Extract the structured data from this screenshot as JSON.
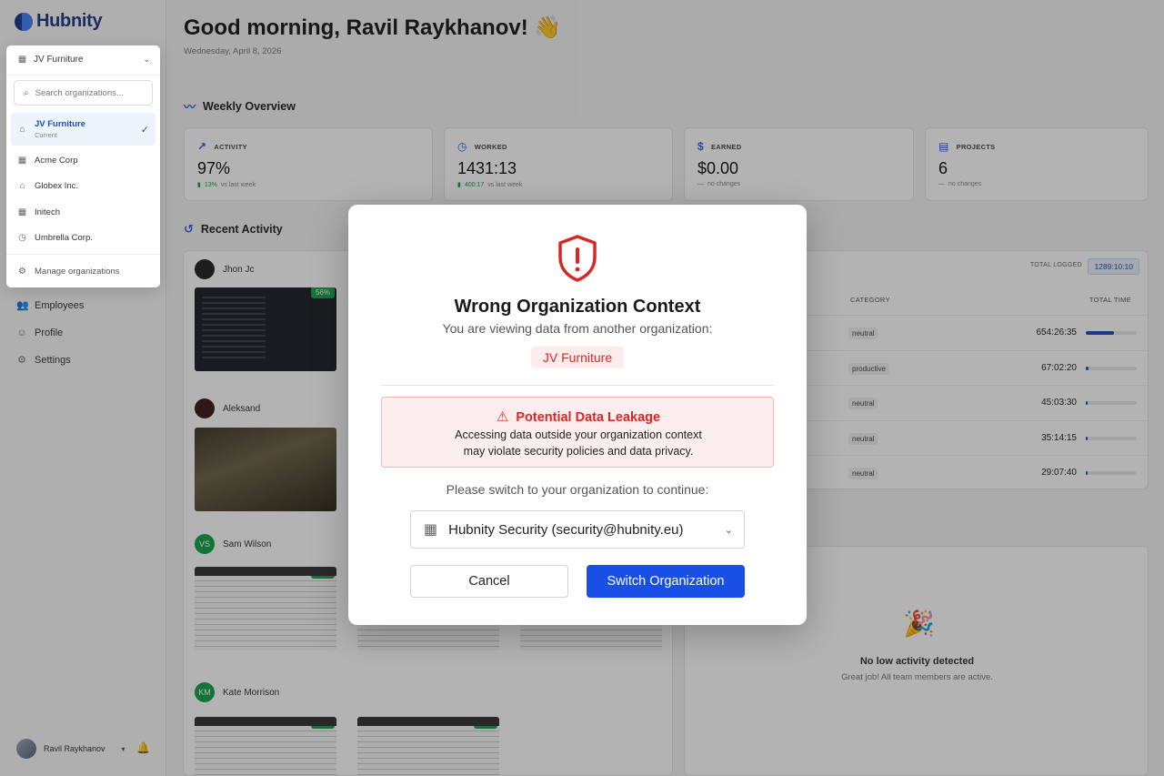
{
  "app": {
    "logo_text": "Hubnity"
  },
  "header": {
    "greeting": "Good morning, Ravil Raykhanov! 👋",
    "date": "Wednesday, April 8, 2026"
  },
  "org_dropdown": {
    "current": "JV Furniture",
    "search_placeholder": "Search organizations...",
    "items": [
      {
        "name": "JV Furniture",
        "sub": "Current"
      },
      {
        "name": "Acme Corp"
      },
      {
        "name": "Globex Inc."
      },
      {
        "name": "Initech"
      },
      {
        "name": "Umbrella Corp."
      }
    ],
    "manage_label": "Manage organizations"
  },
  "sidebar": {
    "items": [
      {
        "label": "Employees"
      },
      {
        "label": "Profile"
      },
      {
        "label": "Settings"
      }
    ],
    "user_name": "Ravil Raykhanov"
  },
  "weekly": {
    "title": "Weekly Overview",
    "stats": [
      {
        "label": "ACTIVITY",
        "value": "97%",
        "change": "13%",
        "change_note": "vs last week"
      },
      {
        "label": "WORKED",
        "value": "1431:13",
        "change": "400:17",
        "change_note": "vs last week"
      },
      {
        "label": "EARNED",
        "value": "$0.00",
        "change": "—",
        "change_note": "no changes"
      },
      {
        "label": "PROJECTS",
        "value": "6",
        "change": "—",
        "change_note": "no changes"
      }
    ]
  },
  "recent": {
    "title": "Recent Activity",
    "people": [
      {
        "name": "Jhon Jc",
        "initials": "",
        "pct": "56%"
      },
      {
        "name": "Aleksand",
        "initials": ""
      },
      {
        "name": "Sam Wilson",
        "initials": "VS",
        "pct": "79%"
      },
      {
        "name": "Kate Morrison",
        "initials": "KM",
        "pct": "71%",
        "pct2": "71%"
      }
    ]
  },
  "apps_table": {
    "total_logged_label": "TOTAL LOGGED",
    "total_logged_value": "1289:10:10",
    "col_category": "CATEGORY",
    "col_time": "TOTAL TIME",
    "rows": [
      {
        "category": "neutral",
        "time": "654:26:35",
        "share": 0.55
      },
      {
        "category": "productive",
        "time": "67:02:20",
        "share": 0.06
      },
      {
        "category": "neutral",
        "time": "45:03:30",
        "share": 0.04
      },
      {
        "category": "neutral",
        "time": "35:14:15",
        "share": 0.03
      },
      {
        "category": "neutral",
        "time": "29:07:40",
        "share": 0.025
      }
    ]
  },
  "low_activity": {
    "title": "No low activity detected",
    "subtitle": "Great job! All team members are active."
  },
  "modal": {
    "title": "Wrong Organization Context",
    "subtitle": "You are viewing data from another organization:",
    "org_name": "JV Furniture",
    "warning_title": "Potential Data Leakage",
    "warning_line1": "Accessing data outside your organization context",
    "warning_line2": "may violate security policies and data privacy.",
    "prompt": "Please switch to your organization to continue:",
    "selected_org": "Hubnity Security (security@hubnity.eu)",
    "cancel_label": "Cancel",
    "switch_label": "Switch Organization"
  },
  "colors": {
    "accent": "#1a4fe6",
    "danger": "#dc2626",
    "success": "#16a34a"
  }
}
